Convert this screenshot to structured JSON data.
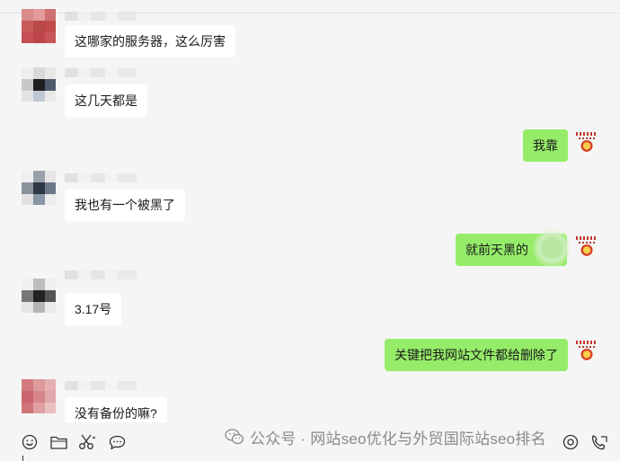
{
  "chat": {
    "messages": [
      {
        "id": "m1",
        "direction": "in",
        "text": "这哪家的服务器，这么厉害"
      },
      {
        "id": "m2",
        "direction": "in",
        "text": "这几天都是"
      },
      {
        "id": "m3",
        "direction": "out",
        "text": "我靠"
      },
      {
        "id": "m4",
        "direction": "in",
        "text": "我也有一个被黑了"
      },
      {
        "id": "m5",
        "direction": "out",
        "text": "就前天黑的"
      },
      {
        "id": "m6",
        "direction": "in",
        "text": "3.17号"
      },
      {
        "id": "m7",
        "direction": "out",
        "text": "关键把我网站文件都给删除了"
      },
      {
        "id": "m8",
        "direction": "in",
        "text": "没有备份的嘛?"
      }
    ]
  },
  "toolbar": {
    "icons": [
      "emoji-icon",
      "folder-icon",
      "scissors-icon",
      "chat-history-icon",
      "voice-call-icon",
      "video-call-icon"
    ]
  },
  "watermark": {
    "text": "公众号 · 网站seo优化与外贸国际站seo排名"
  },
  "colors": {
    "background": "#f5f5f5",
    "incoming_bubble": "#ffffff",
    "outgoing_bubble": "#95ec69",
    "text": "#1a1a1a",
    "watermark": "#8a8a8a"
  }
}
